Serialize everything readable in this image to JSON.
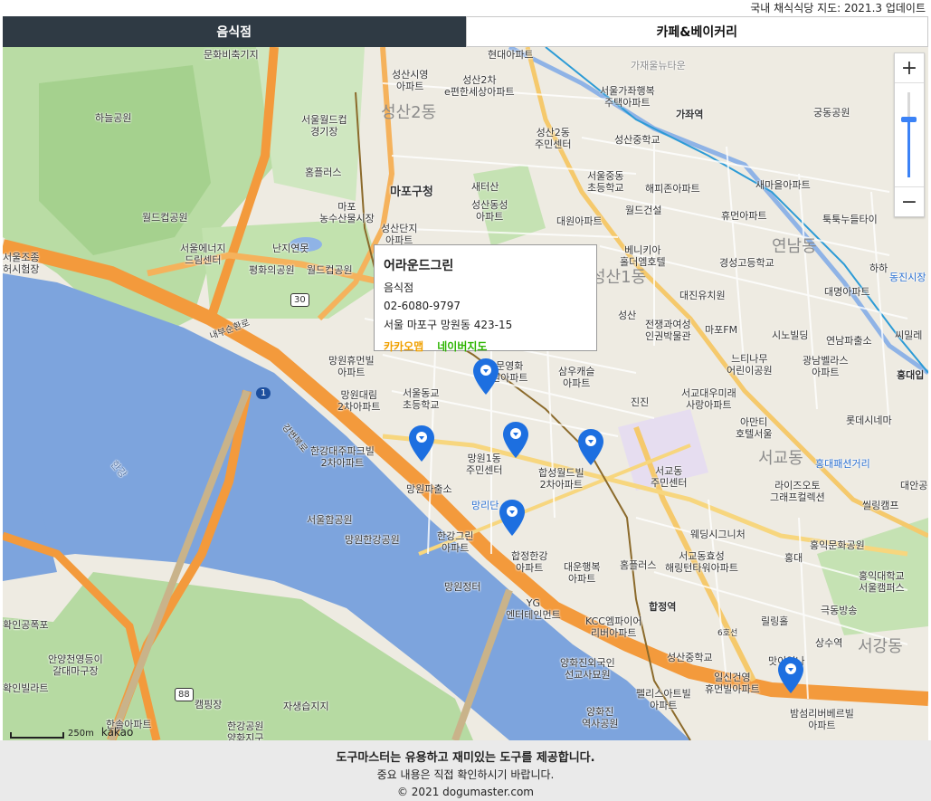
{
  "header": {
    "note": "국내 채식식당 지도: 2021.3 업데이트"
  },
  "tabs": [
    {
      "label": "음식점",
      "active": true
    },
    {
      "label": "카페&베이커리",
      "active": false
    }
  ],
  "map": {
    "zoom_in": "+",
    "zoom_out": "−",
    "zoom_level_fraction": 0.68,
    "scale_label": "250m",
    "provider": "kakao",
    "labels": {
      "l1": "문화비축기지",
      "l2": "하늘공원",
      "l3": "서울월드컵\n경기장",
      "l4": "홈플러스",
      "l5": "월드컵공원",
      "l6": "마포\n농수산물시장",
      "l7": "서울에너지\n드림센터",
      "l8": "난지연못",
      "l9": "평화의공원",
      "l10": "월드컵공원",
      "l11": "서울조종\n허시험장",
      "l12": "성산시영\n아파트",
      "l13": "성산2차\n e편한세상아파트",
      "l14": "현대아파트",
      "l15": "가재울뉴타운",
      "l16": "서울가좌행복\n주택아파트",
      "l17": "가좌역",
      "l18": "궁동공원",
      "l19": "성산2동\n주민센터",
      "l20": "성산중학교",
      "l21": "서울중동\n초등학교",
      "l22": "해피존아파트",
      "l23": "새마을아파트",
      "l24": "마포구청",
      "l25": "새터산",
      "l26": "성산동성\n아파트",
      "l27": "대원아파트",
      "l28": "월드건설",
      "l29": "휴먼아파트",
      "l30": "툭툭누들타이",
      "l31": "성산단지\n아파트",
      "l32": "베니키아\n홀더엠호텔",
      "l33": "경성고등학교",
      "l34": "하하",
      "l35": "동진시장",
      "l36": "대진유치원",
      "l37": "대명아파트",
      "l38": "전쟁과여성\n인권박물관",
      "l39": "마포FM",
      "l40": "성산",
      "l41": "시노빌딩",
      "l42": "연남파출소",
      "l43": "씨밀레",
      "l44": "느티나무\n어린이공원",
      "l45": "광남벨라스\n아파트",
      "l46": "홍대입",
      "l47": "망원휴먼빌\n아파트",
      "l48": "서울동교\n초등학교",
      "l49": "문영화\n원아파트",
      "l50": "삼우캐슬\n아파트",
      "l51": "망원대림\n2차아파트",
      "l52": "진진",
      "l53": "서교대우미래\n사랑아파트",
      "l54": "아만티\n호텔서울",
      "l55": "롯데시네마",
      "l56": "한강대주파크빌\n2차아파트",
      "l57": "망원1동\n주민센터",
      "l58": "합성월드빌\n2차아파트",
      "l59": "서교동\n주민센터",
      "l60": "홍대패션거리",
      "l61": "라이즈오토\n그래프컬렉션",
      "l62": "대안공",
      "l63": "망원파출소",
      "l64": "망리단",
      "l65": "씰링캠프",
      "l66": "서울함공원",
      "l67": "웨딩시그니처",
      "l68": "홍익문화공원",
      "l69": "한강그린\n아파트",
      "l70": "망원한강공원",
      "l71": "합정한강\n아파트",
      "l72": "대운행복\n아파트",
      "l73": "홈플러스",
      "l74": "서교동효성\n해링턴타워아파트",
      "l75": "홍대",
      "l76": "홍익대학교\n서울캠퍼스",
      "l77": "망원정터",
      "l78": "YG\n엔터테인먼트",
      "l79": "합정역",
      "l80": "극동방송",
      "l81": "확인공폭포",
      "l82": "KCC엠파이어\n리버아파트",
      "l83": "릴링홀",
      "l84": "상수역",
      "l85": "안양천영등이\n갈대마구장",
      "l86": "성산중학교",
      "l87": "맛이있나",
      "l88": "양화진외국인\n선교사묘원",
      "l89": "일신건영\n휴먼빌아파트",
      "l90": "캠핑장",
      "l91": "자생습지지",
      "l92": "펠리스아트빌\n아파트",
      "l93": "한강공원\n양화지구",
      "l94": "양화진\n역사공원",
      "l95": "밤섬리버베르빌\n아파트",
      "l96": "한솔아파트",
      "l97": "확인빌라트",
      "l98": "한강"
    },
    "big_labels": {
      "b1": "성산2동",
      "b2": "성산1동",
      "b3": "연남동",
      "b4": "서교동",
      "b5": "서강동"
    },
    "road_labels": {
      "r1": "30",
      "r2": "1",
      "r3": "88",
      "r4": "내부순환로",
      "r5": "강변북로",
      "r6": "6호선"
    }
  },
  "popup": {
    "name": "어라운드그린",
    "category": "음식점",
    "phone": "02-6080-9797",
    "address": "서울 마포구 망원동 423-15",
    "link_kakao": "카카오맵",
    "link_naver": "네이버지도",
    "colors": {
      "kakao": "#f0a000",
      "naver": "#2db400"
    }
  },
  "footer": {
    "line1": "도구마스터는 유용하고 재미있는 도구를 제공합니다.",
    "line2": "중요 내용은 직접 확인하시기 바랍니다.",
    "line3": "© 2021 dogumaster.com"
  },
  "colors": {
    "tab_active_bg": "#2f3a44",
    "marker": "#1d6fe0",
    "river": "#7da4dd",
    "park": "#b7dca0",
    "highway": "#f39a3c"
  }
}
